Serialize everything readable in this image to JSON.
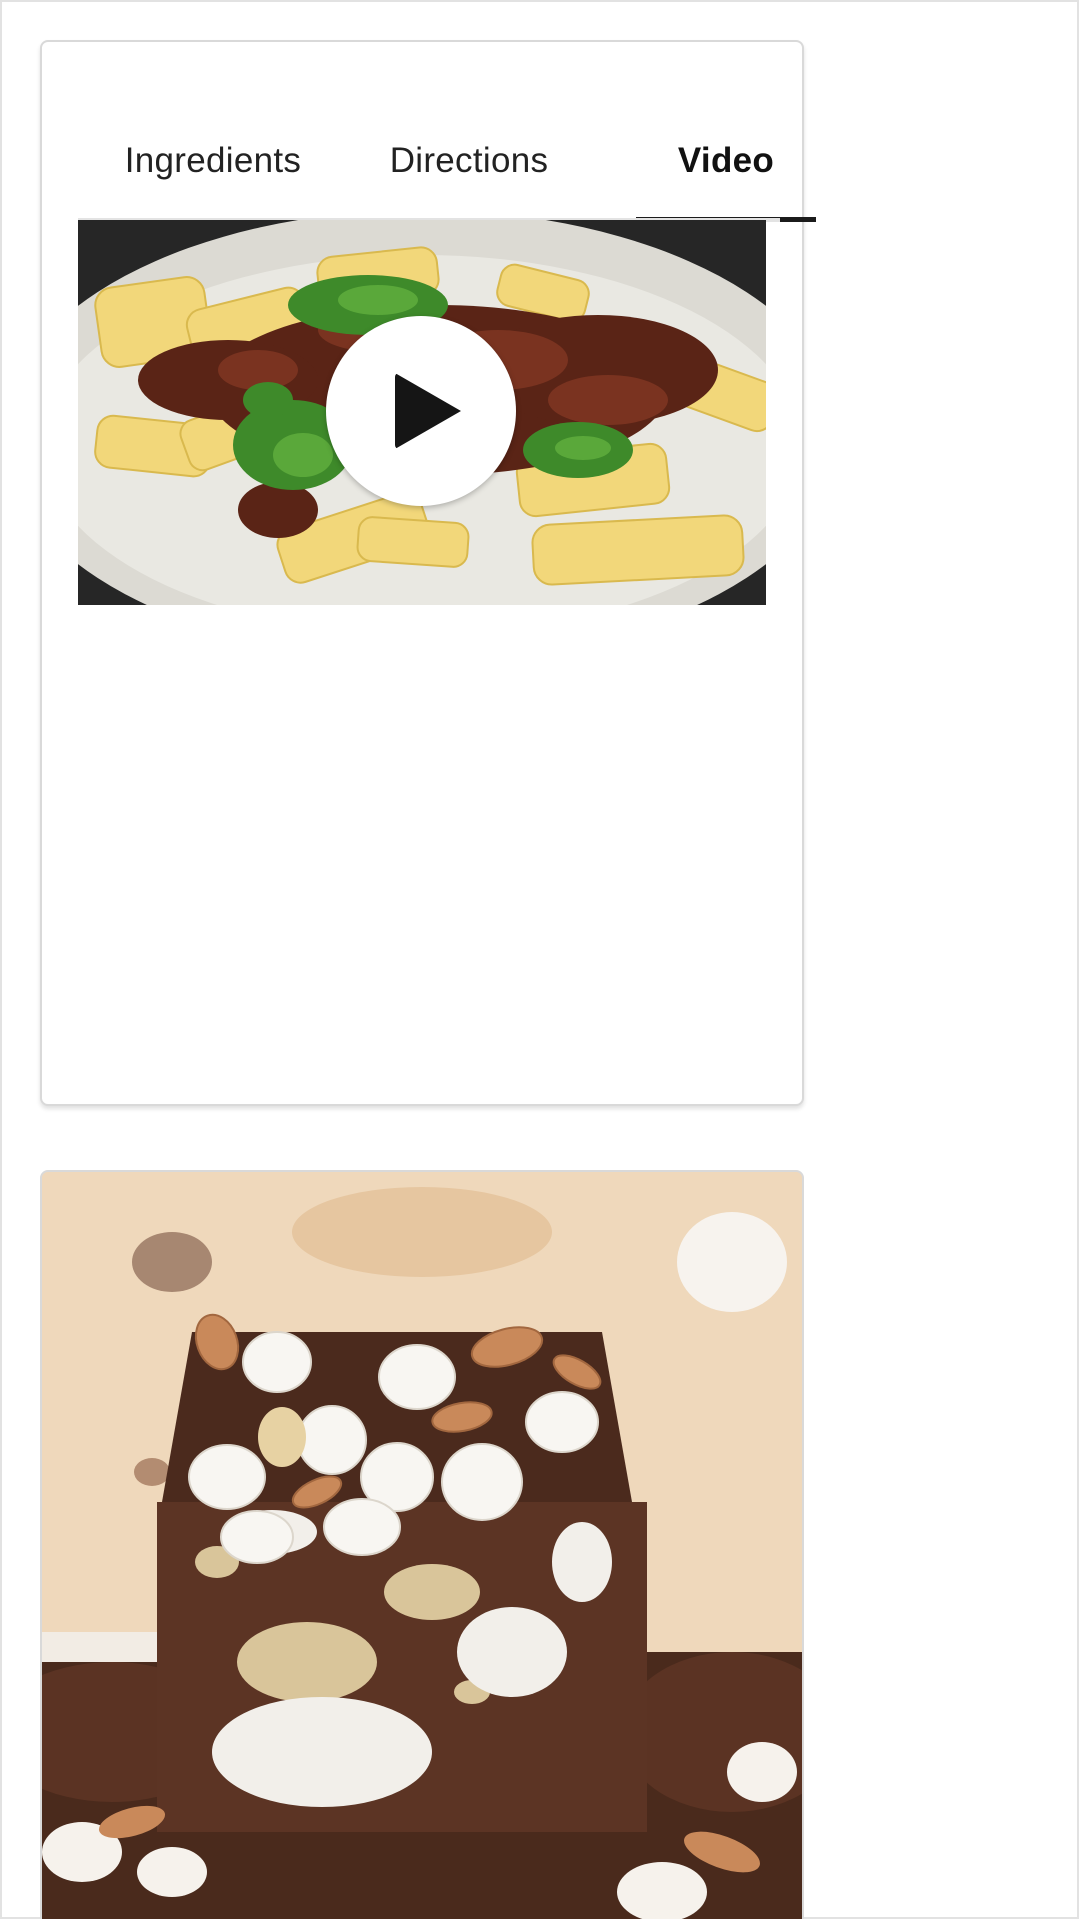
{
  "recipe_panel": {
    "tabs": [
      {
        "label": "Ingredients",
        "active": false
      },
      {
        "label": "Directions",
        "active": false
      },
      {
        "label": "Video",
        "active": true
      }
    ],
    "video": {
      "thumbnail": "rigatoni with bolognese-style sauce and pesto",
      "play_icon": "play-icon"
    }
  },
  "next_recipe": {
    "image": "rocky road chocolate fudge with marshmallows and almonds"
  },
  "colors": {
    "active_tab_underline": "#1b1b1b",
    "inactive_tab_underline": "#e3e3e3",
    "card_border": "#d9d9d9"
  }
}
